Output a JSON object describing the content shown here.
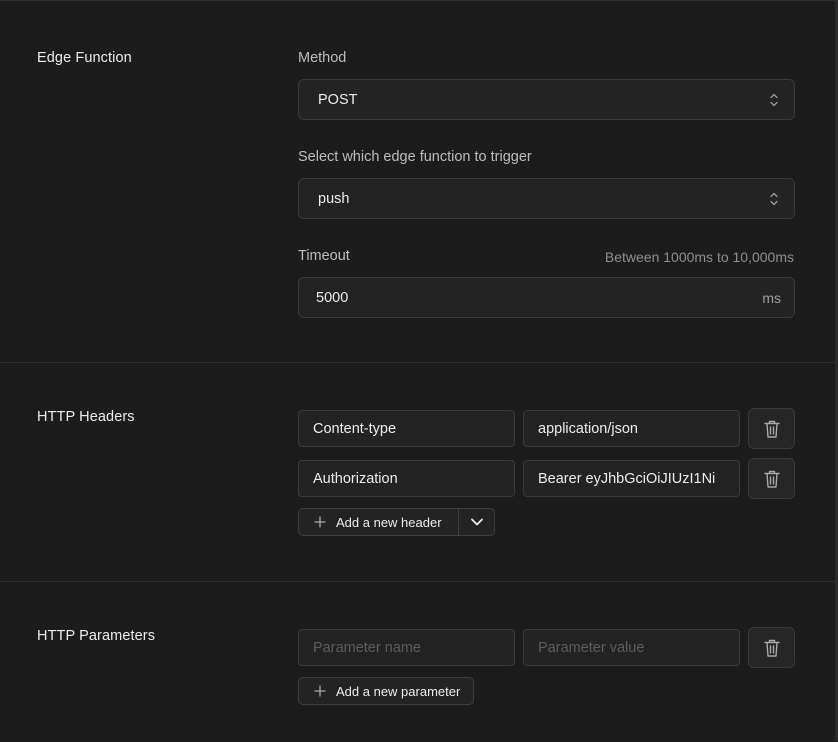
{
  "edge_function": {
    "title": "Edge Function",
    "method": {
      "label": "Method",
      "value": "POST"
    },
    "function_select": {
      "label": "Select which edge function to trigger",
      "value": "push"
    },
    "timeout": {
      "label": "Timeout",
      "hint": "Between 1000ms to 10,000ms",
      "value": "5000",
      "unit": "ms"
    }
  },
  "http_headers": {
    "title": "HTTP Headers",
    "rows": [
      {
        "name": "Content-type",
        "value": "application/json"
      },
      {
        "name": "Authorization",
        "value": "Bearer eyJhbGciOiJIUzI1Ni"
      }
    ],
    "add_label": "Add a new header"
  },
  "http_parameters": {
    "title": "HTTP Parameters",
    "name_placeholder": "Parameter name",
    "value_placeholder": "Parameter value",
    "add_label": "Add a new parameter"
  },
  "icons": {
    "select": "chevron-up-down-icon",
    "delete": "trash-icon",
    "add": "plus-icon",
    "dropdown": "chevron-down-icon"
  }
}
